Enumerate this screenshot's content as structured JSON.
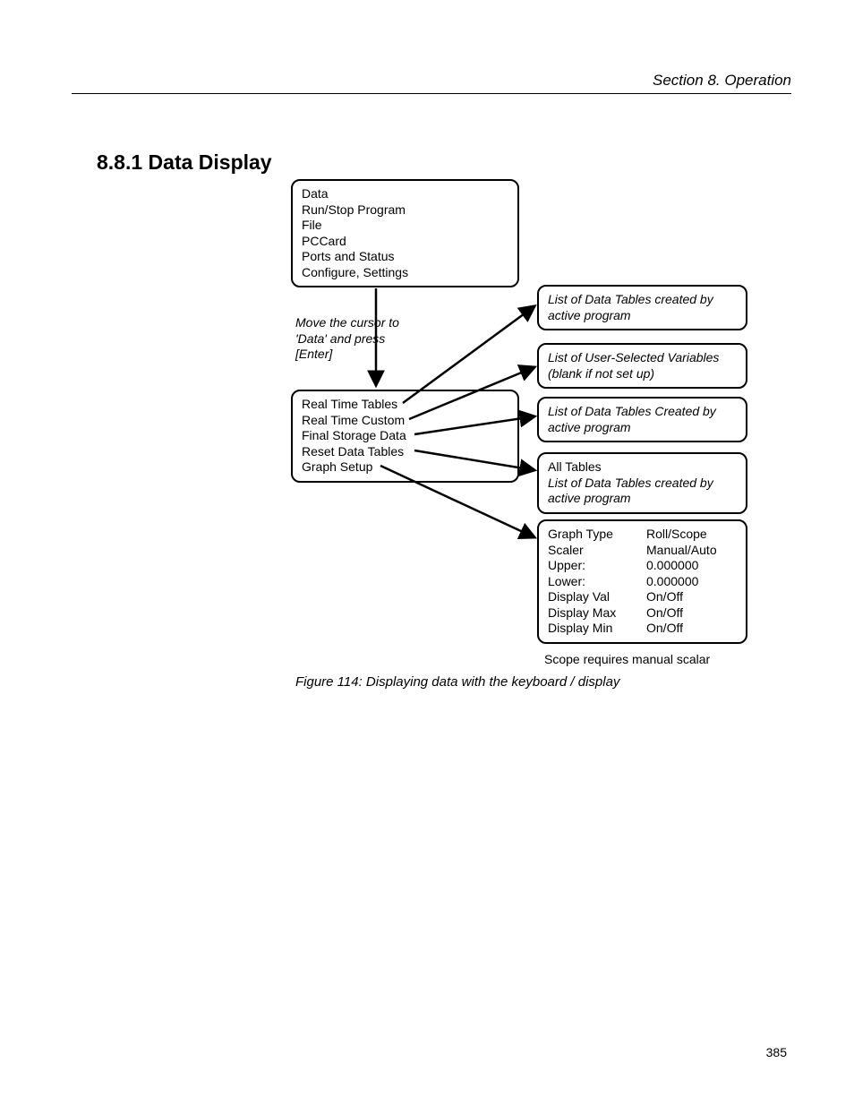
{
  "header": {
    "section": "Section 8.  Operation"
  },
  "heading": "8.8.1 Data Display",
  "figure": {
    "caption": "Figure 114: Displaying data with the keyboard / display",
    "note": "Scope requires manual scalar"
  },
  "page_number": "385",
  "diagram": {
    "main_menu": {
      "items": [
        "Data",
        "Run/Stop Program",
        "File",
        "PCCard",
        "Ports and Status",
        "Configure, Settings"
      ]
    },
    "instruction": "Move the cursor to 'Data' and press [Enter]",
    "data_menu": {
      "items": [
        "Real Time Tables",
        "Real Time Custom",
        "Final Storage Data",
        "Reset Data Tables",
        "Graph Setup"
      ]
    },
    "right_boxes": {
      "b1": "List of Data Tables created by active program",
      "b2": "List of User-Selected Variables (blank if not set up)",
      "b3": "List of Data Tables Created by active program",
      "b4_line1": "All Tables",
      "b4_line2": "List of Data Tables created by active program",
      "graph_setup": {
        "rows": [
          {
            "left": "Graph Type",
            "right": "Roll/Scope"
          },
          {
            "left": "Scaler",
            "right": "Manual/Auto"
          },
          {
            "left": "Upper:",
            "right": "0.000000"
          },
          {
            "left": "Lower:",
            "right": "0.000000"
          },
          {
            "left": "Display Val",
            "right": "On/Off"
          },
          {
            "left": "Display Max",
            "right": "On/Off"
          },
          {
            "left": "Display Min",
            "right": "On/Off"
          }
        ]
      }
    }
  }
}
